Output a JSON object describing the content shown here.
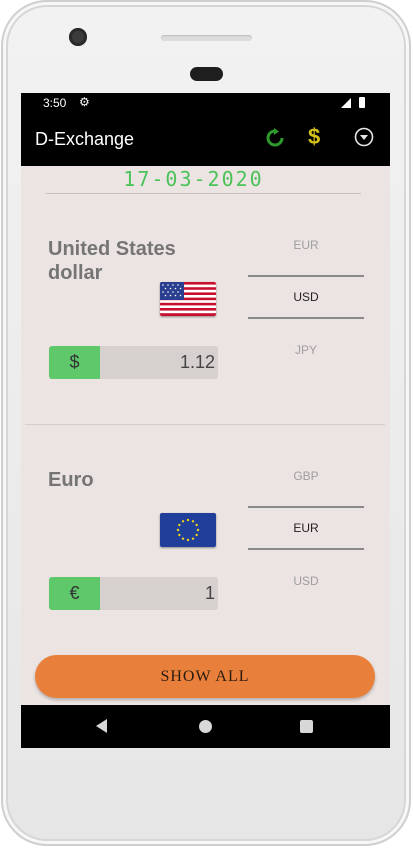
{
  "status_bar": {
    "time": "3:50"
  },
  "app_bar": {
    "title": "D-Exchange",
    "icons": [
      "refresh-icon",
      "dollar-icon",
      "dropdown-icon"
    ],
    "dollar_glyph": "$"
  },
  "date": "17-03-2020",
  "currency_1": {
    "name": "United States dollar",
    "symbol": "$",
    "amount": "1.12",
    "picker": {
      "above": "EUR",
      "selected": "USD",
      "below": "JPY"
    }
  },
  "currency_2": {
    "name": "Euro",
    "symbol": "€",
    "amount": "1",
    "picker": {
      "above": "GBP",
      "selected": "EUR",
      "below": "USD"
    }
  },
  "show_all_label": "SHOW ALL",
  "colors": {
    "accent_green": "#4cc25a",
    "button_orange": "#e8803c",
    "background": "#ece4e2"
  }
}
